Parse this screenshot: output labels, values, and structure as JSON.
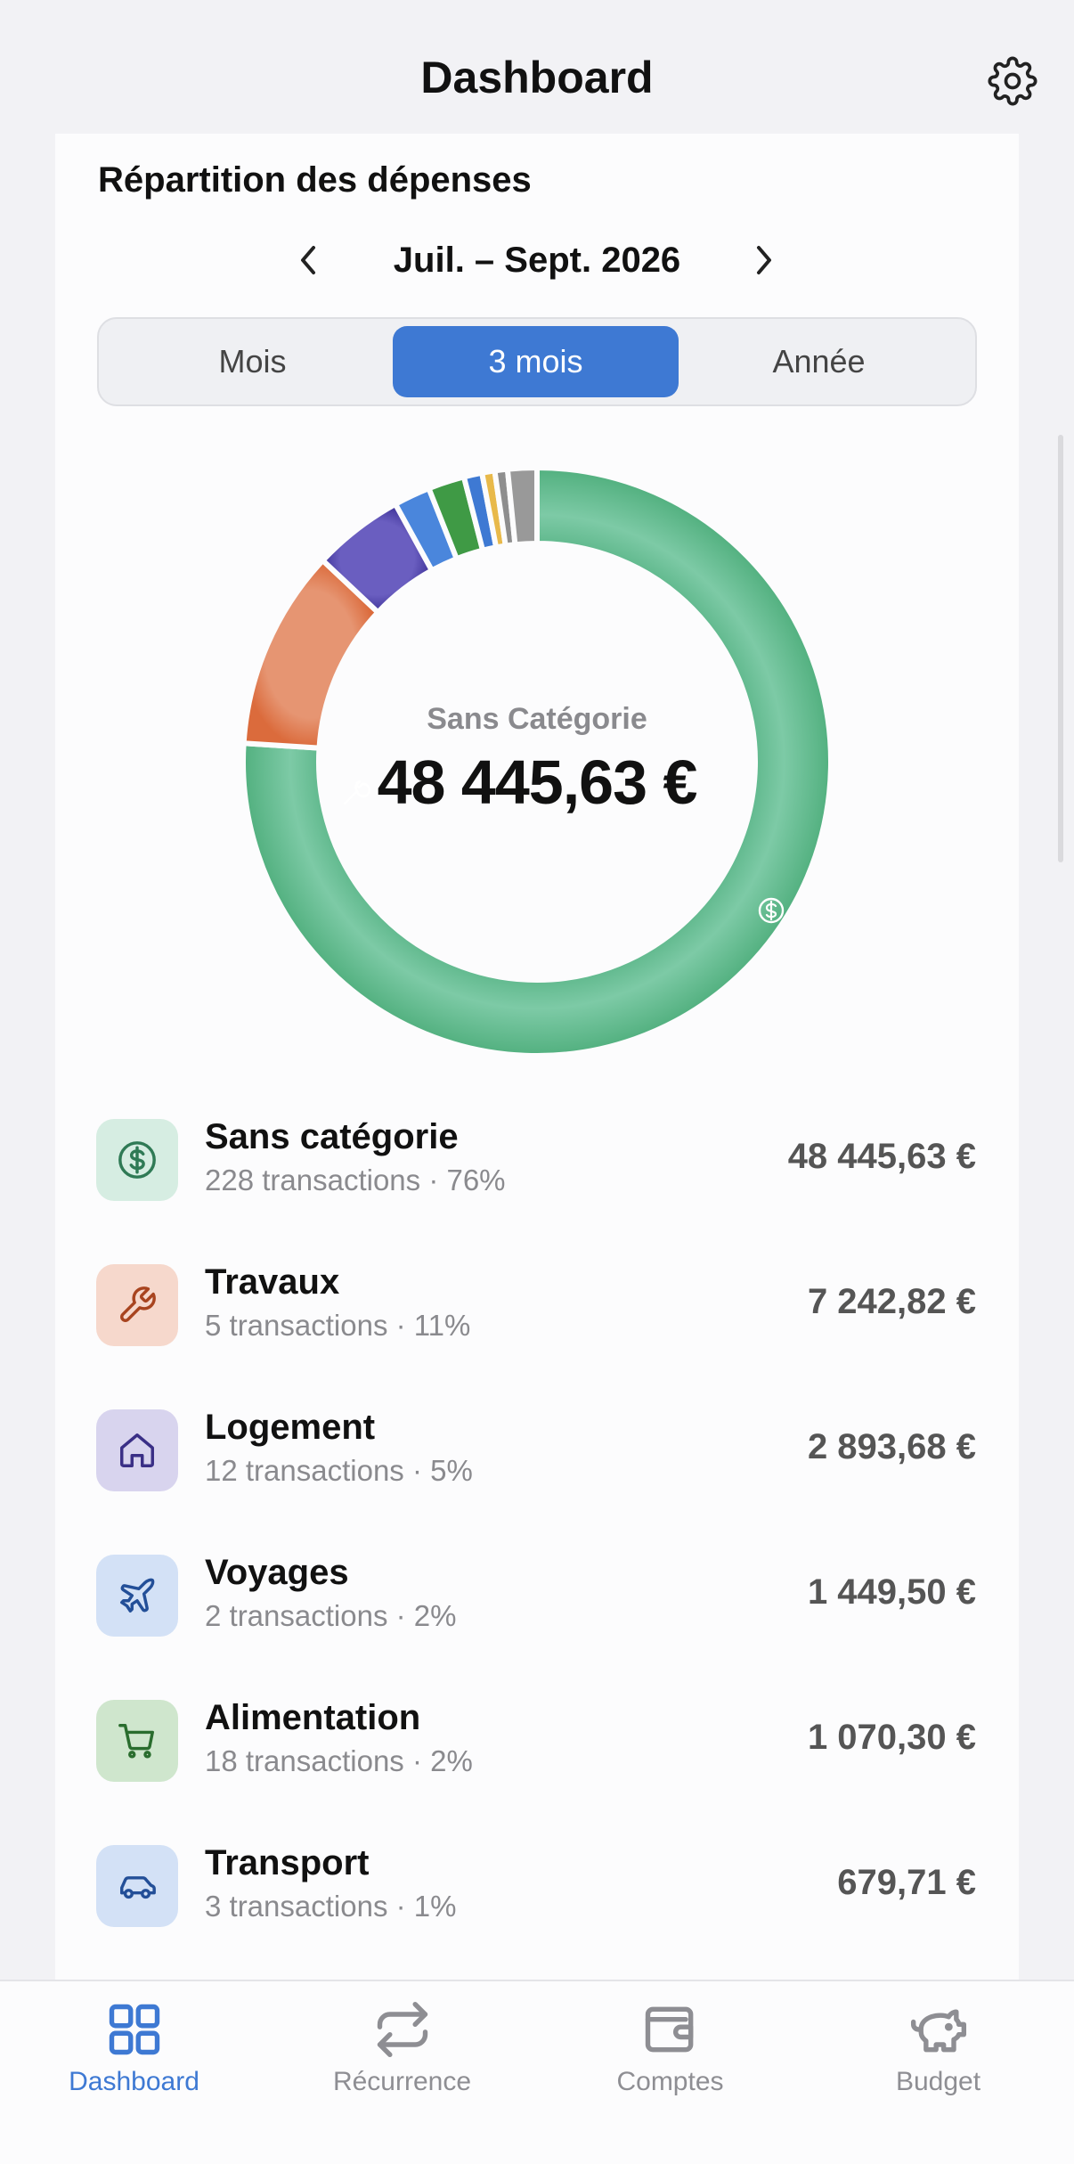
{
  "header": {
    "title": "Dashboard"
  },
  "card": {
    "title": "Répartition des dépenses",
    "period": "Juil. – Sept. 2026",
    "segments": [
      "Mois",
      "3 mois",
      "Année"
    ],
    "selected_segment": "3 mois"
  },
  "donut": {
    "center_label": "Sans Catégorie",
    "center_value": "48 445,63 €"
  },
  "chart_data": {
    "type": "pie",
    "variant": "donut",
    "categories": [
      "Sans catégorie",
      "Travaux",
      "Logement",
      "Voyages",
      "Alimentation",
      "Transport",
      "Other (blue)",
      "Other (yellow)",
      "Other (gray)"
    ],
    "values": [
      76,
      11,
      5,
      2,
      2,
      1,
      0.7,
      0.7,
      1.6
    ],
    "colors": [
      "#5cba8a",
      "#e07a4e",
      "#4b3fa8",
      "#4a86dc",
      "#3f9a45",
      "#3e79d3",
      "#e8b94a",
      "#8e8e8e",
      "#999999"
    ]
  },
  "categories": [
    {
      "name": "Sans catégorie",
      "sub": "228 transactions · 76%",
      "amount": "48 445,63 €",
      "icon": "dollar-circle-icon",
      "bg": "#d6ede2",
      "fg": "#2f7a55"
    },
    {
      "name": "Travaux",
      "sub": "5 transactions · 11%",
      "amount": "7 242,82 €",
      "icon": "wrench-icon",
      "bg": "#f6d8cc",
      "fg": "#a8441f"
    },
    {
      "name": "Logement",
      "sub": "12 transactions · 5%",
      "amount": "2 893,68 €",
      "icon": "house-icon",
      "bg": "#d8d4ee",
      "fg": "#3a2f86"
    },
    {
      "name": "Voyages",
      "sub": "2 transactions · 2%",
      "amount": "1 449,50 €",
      "icon": "airplane-icon",
      "bg": "#d3e1f6",
      "fg": "#234f98"
    },
    {
      "name": "Alimentation",
      "sub": "18 transactions · 2%",
      "amount": "1 070,30 €",
      "icon": "cart-icon",
      "bg": "#cfe6cd",
      "fg": "#2a6d2e"
    },
    {
      "name": "Transport",
      "sub": "3 transactions · 1%",
      "amount": "679,71 €",
      "icon": "car-icon",
      "bg": "#d3e1f6",
      "fg": "#234f98"
    }
  ],
  "tabs": [
    {
      "label": "Dashboard",
      "icon": "grid-icon",
      "active": true
    },
    {
      "label": "Récurrence",
      "icon": "repeat-icon",
      "active": false
    },
    {
      "label": "Comptes",
      "icon": "wallet-icon",
      "active": false
    },
    {
      "label": "Budget",
      "icon": "piggy-bank-icon",
      "active": false
    }
  ],
  "colors": {
    "accent": "#3e79d3",
    "background": "#f2f2f5",
    "card": "#fcfcfd"
  }
}
